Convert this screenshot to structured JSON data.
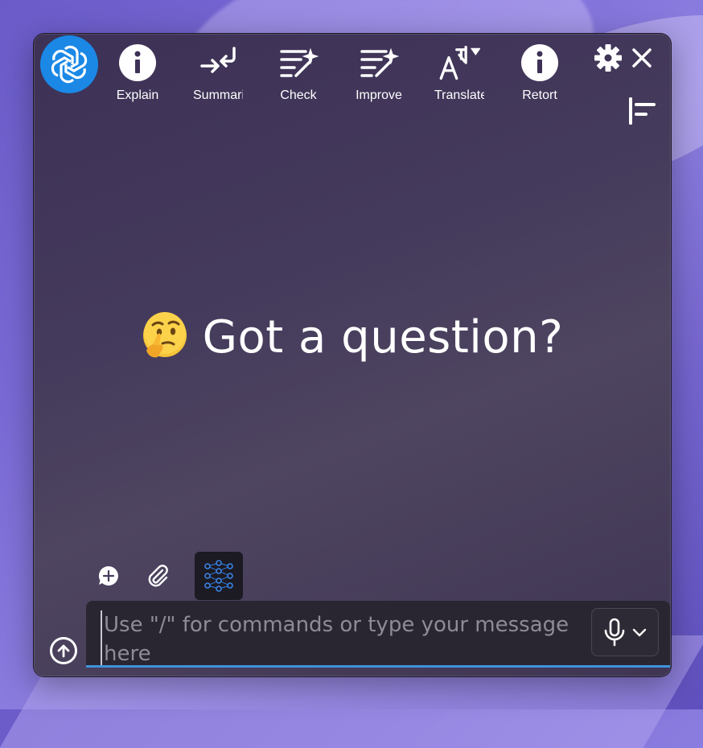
{
  "toolbar": {
    "items": [
      {
        "label": "Explain",
        "icon": "info-icon"
      },
      {
        "label": "Summarize",
        "icon": "collapse-arrows-icon"
      },
      {
        "label": "Check",
        "icon": "text-sparkle-icon"
      },
      {
        "label": "Improve",
        "icon": "text-sparkle-icon"
      },
      {
        "label": "Translate",
        "icon": "translate-icon"
      },
      {
        "label": "Retort",
        "icon": "info-icon"
      }
    ]
  },
  "main": {
    "prompt_text": "Got a question?",
    "prompt_emoji": "thinking-face-emoji"
  },
  "composer": {
    "placeholder": "Use \"/\" for commands or type your message here"
  },
  "colors": {
    "accent": "#3e92dd",
    "logo_bg": "#1b88e6",
    "window_bg": "#453b5c"
  }
}
